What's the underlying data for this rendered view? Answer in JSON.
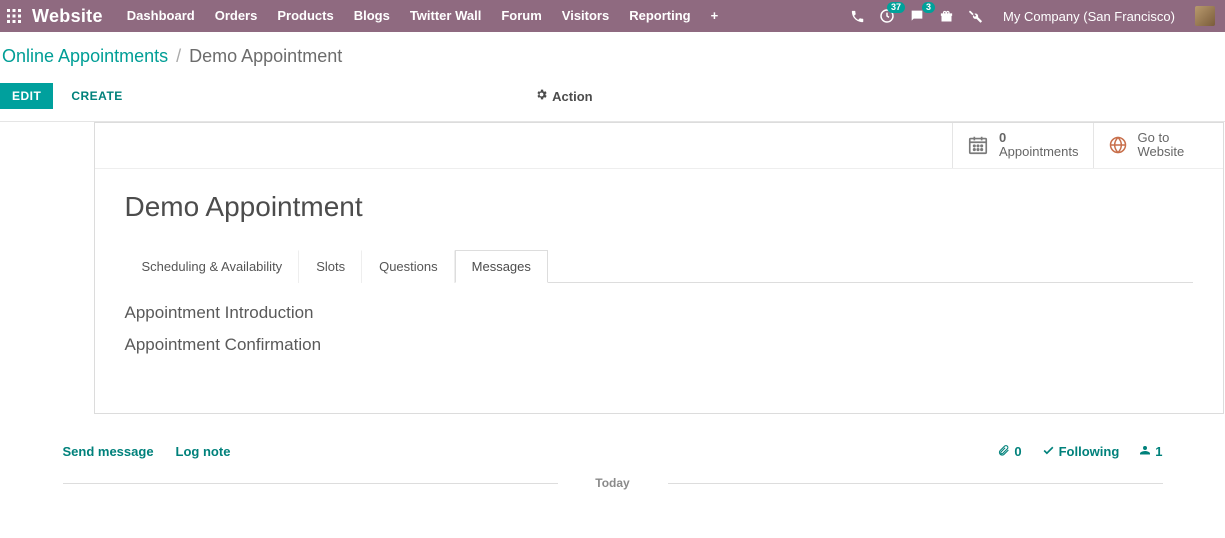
{
  "topbar": {
    "brand": "Website",
    "nav": [
      "Dashboard",
      "Orders",
      "Products",
      "Blogs",
      "Twitter Wall",
      "Forum",
      "Visitors",
      "Reporting"
    ],
    "badge_activities": "37",
    "badge_messages": "3",
    "company": "My Company (San Francisco)"
  },
  "breadcrumb": {
    "root": "Online Appointments",
    "current": "Demo Appointment"
  },
  "actions": {
    "edit": "EDIT",
    "create": "CREATE",
    "action_label": "Action"
  },
  "statbuttons": {
    "appointments_count": "0",
    "appointments_label": "Appointments",
    "goto_line1": "Go to",
    "goto_line2": "Website"
  },
  "record": {
    "title": "Demo Appointment"
  },
  "tabs": {
    "t0": "Scheduling & Availability",
    "t1": "Slots",
    "t2": "Questions",
    "t3": "Messages"
  },
  "messages_tab": {
    "intro_label": "Appointment Introduction",
    "confirm_label": "Appointment Confirmation"
  },
  "chatter": {
    "send": "Send message",
    "lognote": "Log note",
    "attachments_count": "0",
    "following": "Following",
    "followers_count": "1",
    "today": "Today"
  }
}
